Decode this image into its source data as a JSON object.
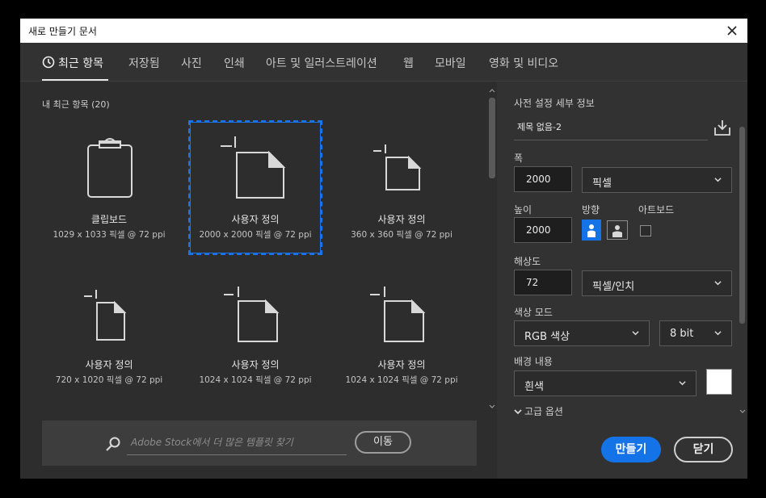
{
  "window": {
    "title": "새로 만들기 문서"
  },
  "tabs": [
    {
      "label": "최근 항목",
      "active": true
    },
    {
      "label": "저장됨"
    },
    {
      "label": "사진"
    },
    {
      "label": "인쇄"
    },
    {
      "label": "아트 및 일러스트레이션"
    },
    {
      "label": "웹"
    },
    {
      "label": "모바일"
    },
    {
      "label": "영화 및 비디오"
    }
  ],
  "recent": {
    "heading": "내 최근 항목 (20)",
    "presets": [
      {
        "name": "클립보드",
        "size": "1029 x 1033 픽셀 @ 72 ppi",
        "icon": "clipboard-icon"
      },
      {
        "name": "사용자 정의",
        "size": "2000 x 2000 픽셀 @ 72 ppi",
        "icon": "custom-doc-icon",
        "selected": true
      },
      {
        "name": "사용자 정의",
        "size": "360 x 360 픽셀 @ 72 ppi",
        "icon": "custom-doc-icon"
      },
      {
        "name": "사용자 정의",
        "size": "720 x 1020 픽셀 @ 72 ppi",
        "icon": "custom-doc-icon"
      },
      {
        "name": "사용자 정의",
        "size": "1024 x 1024 픽셀 @ 72 ppi",
        "icon": "custom-doc-icon"
      },
      {
        "name": "사용자 정의",
        "size": "1024 x 1024 픽셀 @ 72 ppi",
        "icon": "custom-doc-icon"
      }
    ]
  },
  "search": {
    "placeholder": "Adobe Stock에서 더 많은 템플릿 찾기",
    "go_label": "이동"
  },
  "details": {
    "heading": "사전 설정 세부 정보",
    "doc_name": "제목 없음-2",
    "width_label": "폭",
    "width_value": "2000",
    "width_unit": "픽셀",
    "height_label": "높이",
    "height_value": "2000",
    "orientation_label": "방향",
    "artboard_label": "아트보드",
    "artboard_checked": false,
    "resolution_label": "해상도",
    "resolution_value": "72",
    "resolution_unit": "픽셀/인치",
    "color_mode_label": "색상 모드",
    "color_mode_value": "RGB 색상",
    "bit_depth_value": "8 bit",
    "background_label": "배경 내용",
    "background_value": "흰색",
    "background_color": "#ffffff",
    "advanced_label": "고급 옵션"
  },
  "actions": {
    "create_label": "만들기",
    "close_label": "닫기"
  },
  "colors": {
    "accent": "#1473e6",
    "panel_bg": "#323232",
    "grid_bg": "#2d2d2d"
  }
}
